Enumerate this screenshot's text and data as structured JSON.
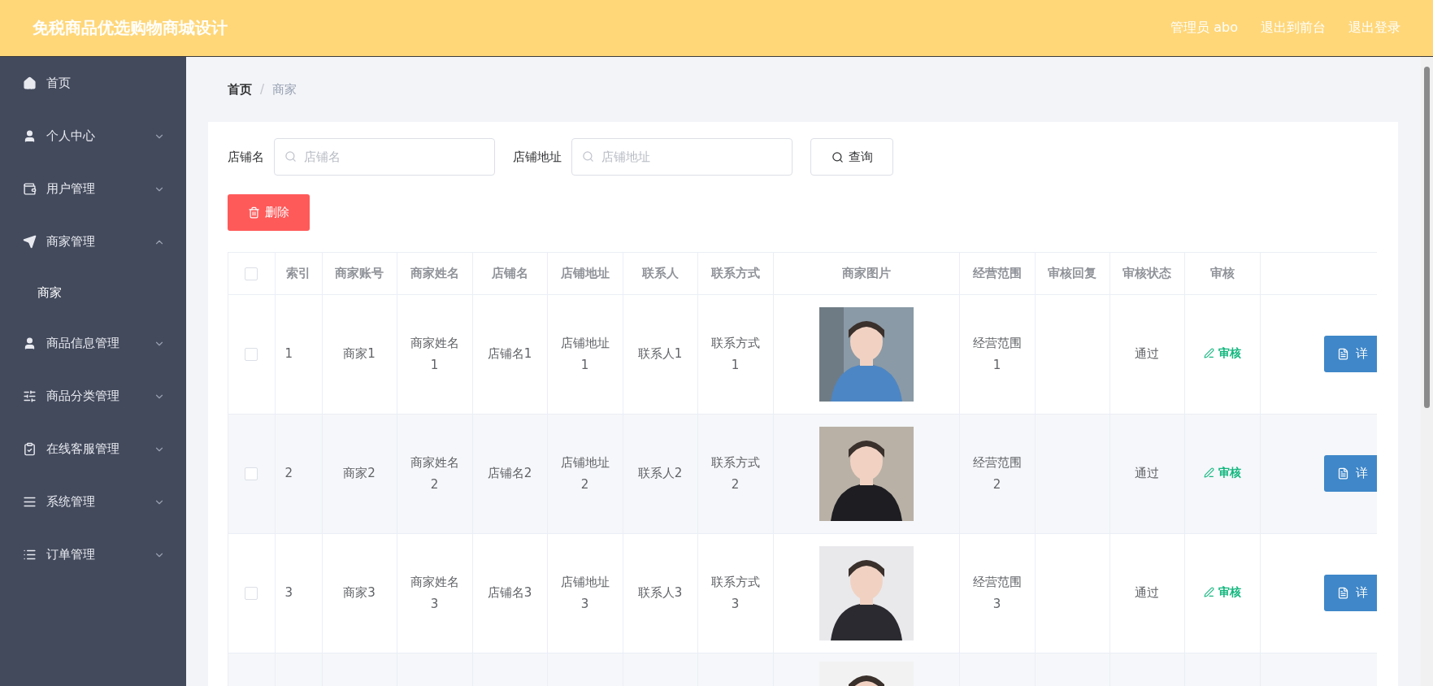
{
  "header": {
    "title": "免税商品优选购物商城设计",
    "links": [
      "管理员 abo",
      "退出到前台",
      "退出登录"
    ]
  },
  "sidebar": {
    "items": [
      {
        "label": "首页"
      },
      {
        "label": "个人中心",
        "expanded": false
      },
      {
        "label": "用户管理",
        "expanded": false
      },
      {
        "label": "商家管理",
        "expanded": true,
        "children": [
          {
            "label": "商家"
          }
        ]
      },
      {
        "label": "商品信息管理",
        "expanded": false
      },
      {
        "label": "商品分类管理",
        "expanded": false
      },
      {
        "label": "在线客服管理",
        "expanded": false
      },
      {
        "label": "系统管理",
        "expanded": false
      },
      {
        "label": "订单管理",
        "expanded": false
      }
    ]
  },
  "breadcrumb": {
    "separator": "/",
    "items": [
      "首页",
      "商家"
    ]
  },
  "search": {
    "fields": [
      {
        "label": "店铺名",
        "placeholder": "店铺名"
      },
      {
        "label": "店铺地址",
        "placeholder": "店铺地址"
      }
    ],
    "button": "查询"
  },
  "delete_button": "删除",
  "table": {
    "select_all": {
      "checked": false
    },
    "columns": [
      "索引",
      "商家账号",
      "商家姓名",
      "店铺名",
      "店铺地址",
      "联系人",
      "联系方式",
      "商家图片",
      "经营范围",
      "审核回复",
      "审核状态",
      "审核"
    ],
    "rows": [
      {
        "checked": false,
        "cells": [
          "1",
          "商家1",
          "商家姓名1",
          "店铺名1",
          "店铺地址1",
          "联系人1",
          "联系方式1"
        ],
        "scope": "经营范围1",
        "status": "通过",
        "review": "审核",
        "detail": "详"
      },
      {
        "checked": false,
        "cells": [
          "2",
          "商家2",
          "商家姓名2",
          "店铺名2",
          "店铺地址2",
          "联系人2",
          "联系方式2"
        ],
        "scope": "经营范围2",
        "status": "通过",
        "review": "审核",
        "detail": "详"
      },
      {
        "checked": false,
        "cells": [
          "3",
          "商家3",
          "商家姓名3",
          "店铺名3",
          "店铺地址3",
          "联系人3",
          "联系方式3"
        ],
        "scope": "经营范围3",
        "status": "通过",
        "review": "审核",
        "detail": "详"
      }
    ]
  }
}
